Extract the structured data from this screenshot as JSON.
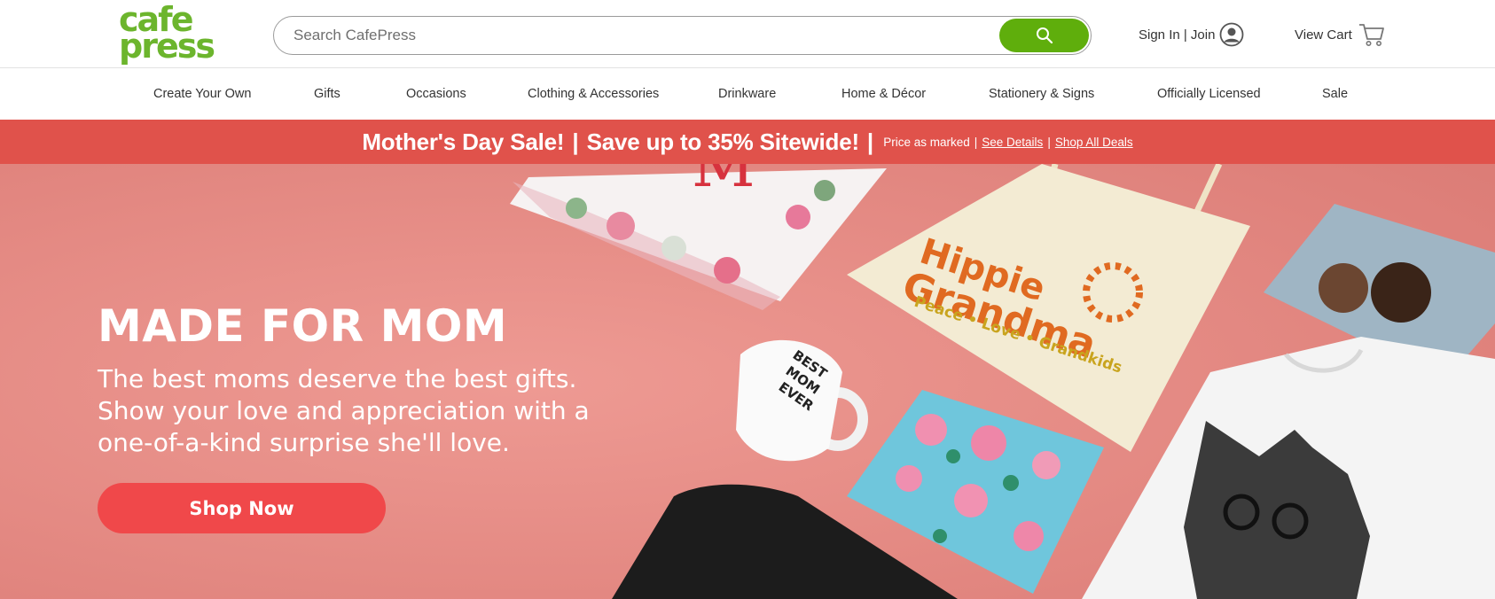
{
  "header": {
    "logo": {
      "line1": "cafe",
      "line2": "press"
    },
    "search": {
      "placeholder": "Search CafePress",
      "value": ""
    },
    "sign_in_label": "Sign In | Join",
    "cart_label": "View Cart"
  },
  "nav": {
    "items": [
      {
        "label": "Create Your Own"
      },
      {
        "label": "Gifts"
      },
      {
        "label": "Occasions"
      },
      {
        "label": "Clothing & Accessories"
      },
      {
        "label": "Drinkware"
      },
      {
        "label": "Home & Décor"
      },
      {
        "label": "Stationery & Signs"
      },
      {
        "label": "Officially Licensed"
      },
      {
        "label": "Sale"
      }
    ]
  },
  "promo": {
    "headline": "Mother's Day Sale!",
    "offer": "Save up to 35% Sitewide!",
    "note": "Price as marked",
    "details_link": "See Details",
    "deals_link": "Shop All Deals"
  },
  "hero": {
    "title": "MADE FOR MOM",
    "copy": "The best moms deserve the best gifts. Show your love and appreciation with a one-of-a-kind surprise she'll love.",
    "cta_label": "Shop Now",
    "products": {
      "pillow_letter": "M",
      "tote_line1": "Hippie",
      "tote_line2": "Grandma",
      "tote_line3": "Peace • Love • Grandkids",
      "mug_line1": "BEST",
      "mug_line2": "MOM",
      "mug_line3": "EVER"
    }
  },
  "colors": {
    "brand_green": "#6cb52d",
    "search_button": "#5fae0c",
    "promo_bar": "#e0524b",
    "hero_bg": "#e98f88",
    "cta": "#f0484a"
  },
  "icons": {
    "search": "search-icon",
    "account": "user-circle-icon",
    "cart": "cart-icon"
  }
}
